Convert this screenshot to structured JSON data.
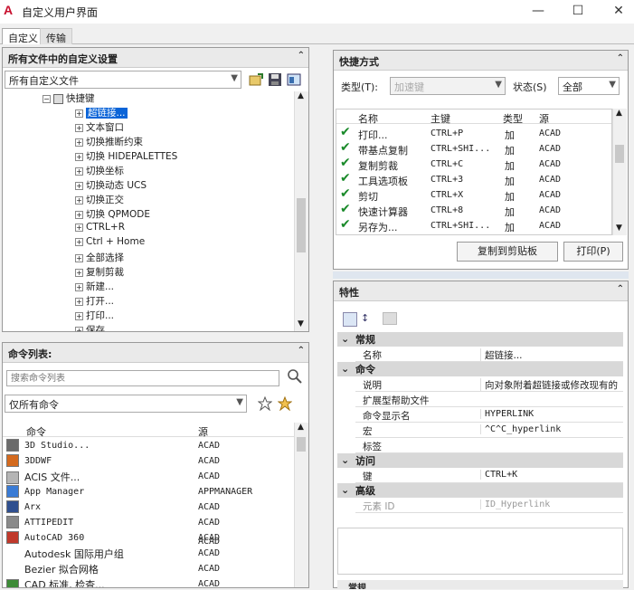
{
  "window": {
    "title": "自定义用户界面",
    "logo": "A",
    "min": "—",
    "max": "☐",
    "close": "✕"
  },
  "tabs": [
    "自定义",
    "传输"
  ],
  "tree_panel": {
    "header": "所有文件中的自定义设置",
    "dropdown": "所有自定义文件",
    "collapse": "⌃",
    "root": "快捷键",
    "items": [
      "超链接...",
      "文本窗口",
      "切换推断约束",
      "切换 HIDEPALETTES",
      "切换坐标",
      "切换动态 UCS",
      "切换正交",
      "切换 QPMODE",
      "CTRL+R",
      "Ctrl + Home",
      "全部选择",
      "复制剪裁",
      "新建...",
      "打开...",
      "打印...",
      "保存"
    ]
  },
  "command_panel": {
    "header": "命令列表:",
    "search_placeholder": "搜索命令列表",
    "filter": "仅所有命令",
    "col_command": "命令",
    "col_source": "源",
    "rows": [
      {
        "name": "3D Studio...",
        "src": "ACAD"
      },
      {
        "name": "3DDWF",
        "src": "ACAD"
      },
      {
        "name": "ACIS 文件...",
        "src": "ACAD"
      },
      {
        "name": "App Manager",
        "src": "APPMANAGER"
      },
      {
        "name": "Arx",
        "src": "ACAD"
      },
      {
        "name": "ATTIPEDIT",
        "src": "ACAD"
      },
      {
        "name": "AutoCAD 360",
        "src": "ACAD"
      },
      {
        "name": "Autodesk 国际用户组",
        "src": "ACAD"
      },
      {
        "name": "Bezier 拟合网格",
        "src": "ACAD"
      },
      {
        "name": "CAD 标准, 检查...",
        "src": "ACAD"
      }
    ]
  },
  "shortcut_panel": {
    "header": "快捷方式",
    "type_label": "类型(T):",
    "type_value": "加速键",
    "status_label": "状态(S)",
    "status_value": "全部",
    "columns": [
      "名称",
      "主键",
      "类型",
      "源"
    ],
    "rows": [
      {
        "name": "打印...",
        "key": "CTRL+P",
        "type": "加",
        "src": "ACAD"
      },
      {
        "name": "带基点复制",
        "key": "CTRL+SHI...",
        "type": "加",
        "src": "ACAD"
      },
      {
        "name": "复制剪裁",
        "key": "CTRL+C",
        "type": "加",
        "src": "ACAD"
      },
      {
        "name": "工具选项板",
        "key": "CTRL+3",
        "type": "加",
        "src": "ACAD"
      },
      {
        "name": "剪切",
        "key": "CTRL+X",
        "type": "加",
        "src": "ACAD"
      },
      {
        "name": "快速计算器",
        "key": "CTRL+8",
        "type": "加",
        "src": "ACAD"
      },
      {
        "name": "另存为...",
        "key": "CTRL+SHI...",
        "type": "加",
        "src": "ACAD"
      }
    ],
    "copy_button": "复制到剪贴板",
    "print_button": "打印(P)"
  },
  "properties_panel": {
    "header": "特性",
    "categories": [
      {
        "name": "常规",
        "rows": [
          {
            "k": "名称",
            "v": "超链接..."
          }
        ]
      },
      {
        "name": "命令",
        "rows": [
          {
            "k": "说明",
            "v": "向对象附着超链接或修改现有的"
          },
          {
            "k": "扩展型帮助文件",
            "v": ""
          },
          {
            "k": "命令显示名",
            "v": "HYPERLINK"
          },
          {
            "k": "宏",
            "v": "^C^C_hyperlink"
          },
          {
            "k": "标签",
            "v": ""
          }
        ]
      },
      {
        "name": "访问",
        "rows": [
          {
            "k": "键",
            "v": "CTRL+K"
          }
        ]
      },
      {
        "name": "高级",
        "rows": [
          {
            "k": "元素 ID",
            "v": "ID_Hyperlink"
          }
        ]
      }
    ],
    "bottom_header": "常规"
  }
}
